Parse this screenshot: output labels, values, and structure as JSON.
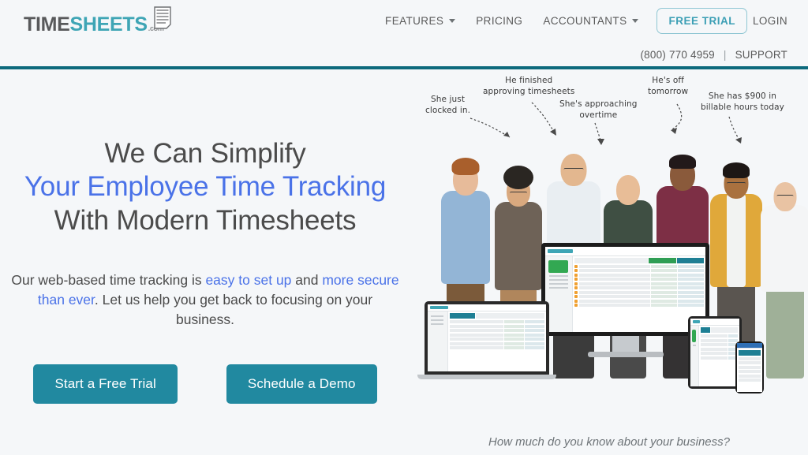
{
  "brand": {
    "logo_time": "TIME",
    "logo_sheets": "SHEETS",
    "logo_dotcom": ".com",
    "logo_icon": "timesheet-document-icon",
    "teal": "#2189a0",
    "teal_border": "#0d6a7d",
    "logo_teal": "#3ea5b5",
    "blue": "#4a72e8",
    "background": "#f5f7f9"
  },
  "nav": {
    "items": [
      {
        "label": "FEATURES",
        "has_dropdown": true
      },
      {
        "label": "PRICING",
        "has_dropdown": false
      },
      {
        "label": "ACCOUNTANTS",
        "has_dropdown": true
      }
    ],
    "free_trial": "FREE TRIAL",
    "login": "LOGIN"
  },
  "subheader": {
    "phone": "(800) 770 4959",
    "separator": "|",
    "support": "SUPPORT"
  },
  "hero": {
    "headline_line1": "We Can Simplify",
    "headline_line2": "Your Employee Time Tracking",
    "headline_line3": "With Modern Timesheets",
    "subtext_part1": "Our web-based time tracking is ",
    "subtext_link1": "easy to set up",
    "subtext_part2": " and ",
    "subtext_link2": "more secure than ever",
    "subtext_part3": ". Let us help you get back to focusing on your business.",
    "cta_primary": "Start a Free Trial",
    "cta_secondary": "Schedule a Demo",
    "caption": "How much do you know about your business?"
  },
  "annotations": [
    {
      "id": "clocked-in",
      "line1": "She just",
      "line2": "clocked in."
    },
    {
      "id": "approving-timesheets",
      "line1": "He finished",
      "line2": "approving timesheets"
    },
    {
      "id": "approaching-overtime",
      "line1": "She's approaching",
      "line2": "overtime"
    },
    {
      "id": "off-tomorrow",
      "line1": "He's off",
      "line2": "tomorrow"
    },
    {
      "id": "billable-hours",
      "line1": "She has $900 in",
      "line2": "billable hours today"
    }
  ]
}
